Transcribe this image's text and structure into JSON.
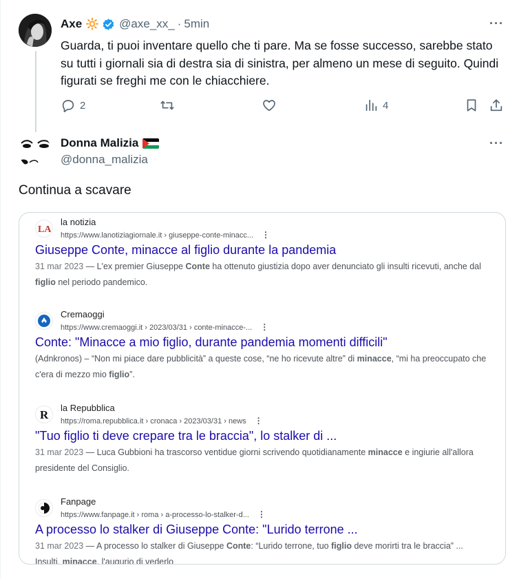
{
  "tweet1": {
    "name": "Axe",
    "name_emoji": "🔆",
    "handle": "@axe_xx_",
    "separator": "·",
    "time": "5min",
    "more": "···",
    "text": "Guarda, ti puoi inventare quello che ti pare. Ma se fosse successo, sarebbe stato su tutti i giornali sia di destra sia di sinistra, per almeno un mese di seguito. Quindi figurati se freghi me con le chiacchiere.",
    "replies": "2",
    "views": "4"
  },
  "tweet2": {
    "name": "Donna Malizia",
    "handle": "@donna_malizia",
    "more": "···",
    "text": "Continua a scavare"
  },
  "results": [
    {
      "site": "la notizia",
      "url": "https://www.lanotiziagiornale.it › giuseppe-conte-minacc...",
      "title": "Giuseppe Conte, minacce al figlio durante la pandemia",
      "date": "31 mar 2023",
      "snippet_parts": [
        "L'ex premier Giuseppe ",
        "Conte",
        " ha ottenuto giustizia dopo aver denunciato gli insulti ricevuti, anche dal ",
        "figlio",
        " nel periodo pandemico."
      ]
    },
    {
      "site": "Cremaoggi",
      "url": "https://www.cremaoggi.it › 2023/03/31 › conte-minacce-...",
      "title": "Conte: \"Minacce a mio figlio, durante pandemia momenti difficili\"",
      "date": "",
      "snippet_parts": [
        "(Adnkronos) – “Non mi piace dare pubblicità” a queste cose, “ne ho ricevute altre” di ",
        "minacce",
        ", “mi ha preoccupato che c'era di mezzo mio ",
        "figlio",
        "”."
      ]
    },
    {
      "site": "la Repubblica",
      "url": "https://roma.repubblica.it › cronaca › 2023/03/31 › news",
      "title": "\"Tuo figlio ti deve crepare tra le braccia\", lo stalker di ...",
      "date": "31 mar 2023",
      "snippet_parts": [
        "Luca Gubbioni ha trascorso ventidue giorni scrivendo quotidianamente ",
        "minacce",
        " e ingiurie all'allora presidente del Consiglio."
      ]
    },
    {
      "site": "Fanpage",
      "url": "https://www.fanpage.it › roma › a-processo-lo-stalker-d...",
      "title": "A processo lo stalker di Giuseppe Conte: \"Lurido terrone ...",
      "date": "31 mar 2023",
      "snippet_parts": [
        "A processo lo stalker di Giuseppe ",
        "Conte",
        ": “Lurido terrone, tuo ",
        "figlio",
        " deve morirti tra le braccia” ... Insulti, ",
        "minacce",
        ", l'augurio di vederlo"
      ]
    }
  ],
  "colors": {
    "verified": "#1d9bf0",
    "link_title": "#1a0dab",
    "muted": "#536471"
  }
}
